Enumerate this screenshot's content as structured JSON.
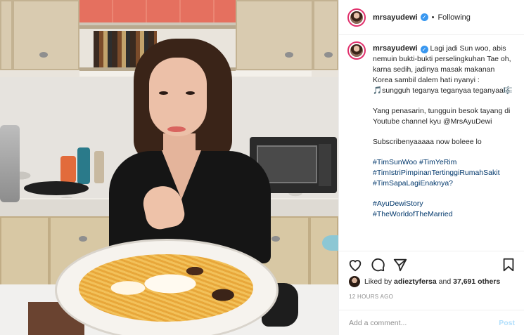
{
  "post": {
    "username": "mrsayudewi",
    "follow_status": "Following",
    "separator": "•",
    "caption": {
      "line1": "Lagi jadi Sun woo, abis nemuin bukti-bukti perselingkuhan Tae oh, karna sedih, jadinya masak makanan Korea sambil dalem hati nyanyi : 🎵sungguh teganya teganyaa teganyaa🎼",
      "line2": "Yang penasarin, tungguin besok tayang di Youtube channel kyu @MrsAyuDewi",
      "line3": "Subscribenyaaaaa now boleee lo",
      "hashtags_a": [
        "#TimSunWoo #TimYeRim",
        "#TimIstriPimpinanTertinggiRumahSakit",
        "#TimSapaLagiEnaknya?"
      ],
      "hashtags_b": [
        "#AyuDewiStory",
        "#TheWorldofTheMarried"
      ]
    },
    "likes": {
      "prefix": "Liked by",
      "user": "adieztyfersa",
      "connector": "and",
      "count": "37,691 others"
    },
    "time_ago": "12 HOURS AGO",
    "comment": {
      "placeholder": "Add a comment...",
      "post_label": "Post"
    },
    "icons": {
      "like": "heart-icon",
      "comment": "comment-icon",
      "share": "share-icon",
      "save": "bookmark-icon"
    },
    "colors": {
      "link": "#00376b",
      "verified": "#3897f0",
      "post_button": "#b2dffc",
      "muted": "#8e8e8e"
    }
  }
}
